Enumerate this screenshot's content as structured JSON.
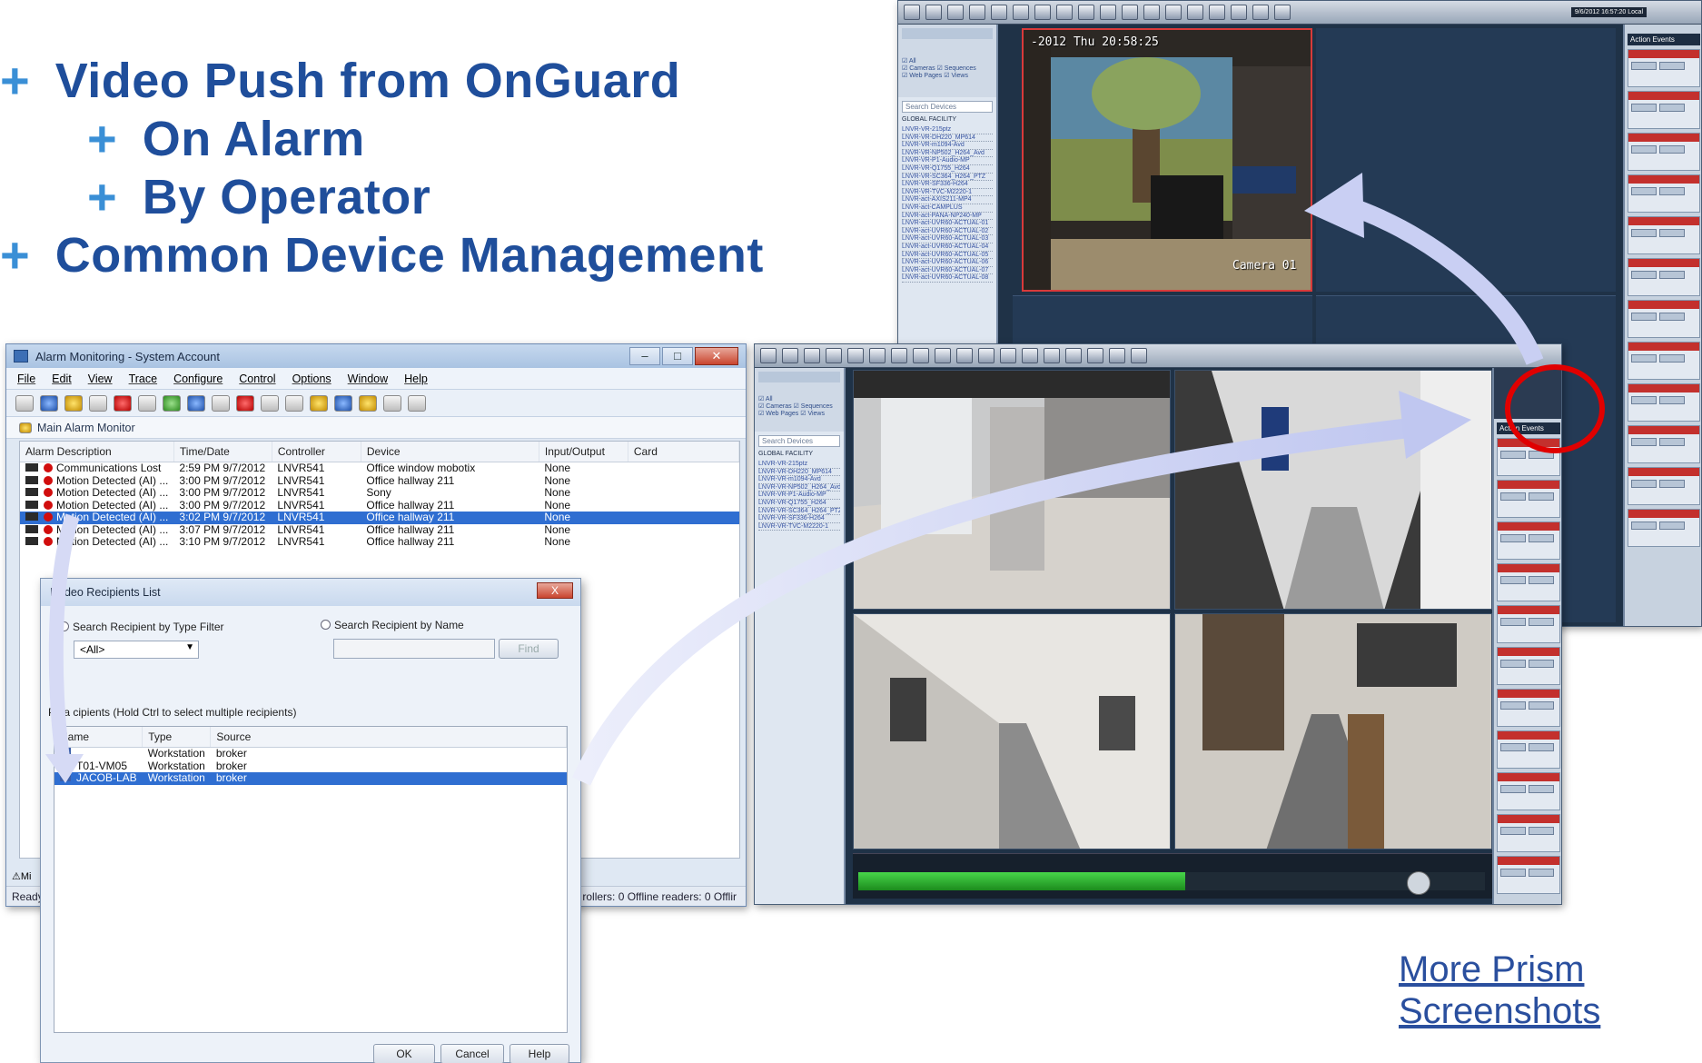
{
  "slide": {
    "bullets": [
      {
        "text": "Video Push from OnGuard",
        "level": 1
      },
      {
        "text": "On Alarm",
        "level": 2
      },
      {
        "text": "By Operator",
        "level": 2
      },
      {
        "text": "Common Device Management",
        "level": 1
      }
    ],
    "link_line1": "More Prism",
    "link_line2": "Screenshots",
    "plus_glyph": "+",
    "colors": {
      "bullet_text": "#1f4e9b",
      "plus": "#3a8fd6",
      "arrow": "#c9cff3",
      "highlight_ring": "#e00000"
    }
  },
  "alarm_window": {
    "title": "Alarm Monitoring - System Account",
    "menu": [
      "File",
      "Edit",
      "View",
      "Trace",
      "Configure",
      "Control",
      "Options",
      "Window",
      "Help"
    ],
    "monitor_title": "Main Alarm Monitor",
    "columns": [
      "Alarm Description",
      "Time/Date",
      "Controller",
      "Device",
      "Input/Output",
      "Card"
    ],
    "rows": [
      {
        "desc": "Communications Lost",
        "time": "2:59 PM 9/7/2012",
        "controller": "LNVR541",
        "device": "Office window mobotix",
        "io": "None"
      },
      {
        "desc": "Motion Detected (AI) ...",
        "time": "3:00 PM 9/7/2012",
        "controller": "LNVR541",
        "device": "Office hallway 211",
        "io": "None"
      },
      {
        "desc": "Motion Detected (AI) ...",
        "time": "3:00 PM 9/7/2012",
        "controller": "LNVR541",
        "device": "Sony",
        "io": "None"
      },
      {
        "desc": "Motion Detected (AI) ...",
        "time": "3:00 PM 9/7/2012",
        "controller": "LNVR541",
        "device": "Office hallway 211",
        "io": "None"
      },
      {
        "desc": "Motion Detected (AI) ...",
        "time": "3:02 PM 9/7/2012",
        "controller": "LNVR541",
        "device": "Office hallway 211",
        "io": "None"
      },
      {
        "desc": "Motion Detected (AI) ...",
        "time": "3:07 PM 9/7/2012",
        "controller": "LNVR541",
        "device": "Office hallway 211",
        "io": "None"
      },
      {
        "desc": "Motion Detected (AI) ...",
        "time": "3:10 PM 9/7/2012",
        "controller": "LNVR541",
        "device": "Office hallway 211",
        "io": "None"
      }
    ],
    "selected_row": 4,
    "status_ready": "Ready",
    "status_right": "rollers: 0   Offline readers: 0   Offlir"
  },
  "dialog": {
    "title": "Li  ideo Recipients List",
    "close": "X",
    "radio_type": "Search Recipient by Type Filter",
    "radio_name": "Search Recipient by Name",
    "type_value": "<All>",
    "find": "Find",
    "instruction": "Plea        cipients (Hold Ctrl to select multiple recipients)",
    "columns": [
      "Name",
      "Type",
      "Source"
    ],
    "rows": [
      {
        "name": "",
        "type": "Workstation",
        "source": "broker"
      },
      {
        "name": "T01-VM05",
        "type": "Workstation",
        "source": "broker"
      },
      {
        "name": "JACOB-LAB",
        "type": "Workstation",
        "source": "broker"
      }
    ],
    "selected_row": 2,
    "ok": "OK",
    "cancel": "Cancel",
    "help": "Help"
  },
  "prism_back": {
    "timestamp": "-2012 Thu 20:58:25",
    "camera_label": "Camera 01",
    "header_right": "9/6/2012 16:57:20  Local",
    "panel_title": "Action Events",
    "search": "Search Devices",
    "tree_root": "GLOBAL FACILITY",
    "devices": [
      "LNVR-VR-215ptz",
      "LNVR-VR-DH220_MP614",
      "LNVR-VR-m1094-Avd",
      "LNVR-VR-NP502_H264_Avd",
      "LNVR-VR-P1-Audio-MP",
      "LNVR-VR-Q1755_H264",
      "LNVR-VR-SC364_H264_PTZ",
      "LNVR-VR-SF336-H264",
      "LNVR-VR-TVC-M2220-1",
      "LNVR-act-AXIS211-MP4",
      "LNVR-act-CAMPLUS",
      "LNVR-act-PANA-NP240-MP",
      "LNVR-act-UVR60-ACTUAL-01",
      "LNVR-act-UVR60-ACTUAL-02",
      "LNVR-act-UVR60-ACTUAL-03",
      "LNVR-act-UVR60-ACTUAL-04",
      "LNVR-act-UVR60-ACTUAL-05",
      "LNVR-act-UVR60-ACTUAL-06",
      "LNVR-act-UVR60-ACTUAL-07",
      "LNVR-act-UVR60-ACTUAL-08"
    ]
  },
  "prism_front": {
    "panel_title": "Action Events",
    "search": "Search Devices",
    "tree_root": "GLOBAL FACILITY",
    "devices": [
      "LNVR-VR-215ptz",
      "LNVR-VR-DH220_MP614",
      "LNVR-VR-m1094-Avd",
      "LNVR-VR-NP502_H264_Avd",
      "LNVR-VR-P1-Audio-MP",
      "LNVR-VR-Q1755_H264",
      "LNVR-VR-SC364_H264_PTZ",
      "LNVR-VR-SF336-H264",
      "LNVR-VR-TVC-M2220-1"
    ]
  }
}
